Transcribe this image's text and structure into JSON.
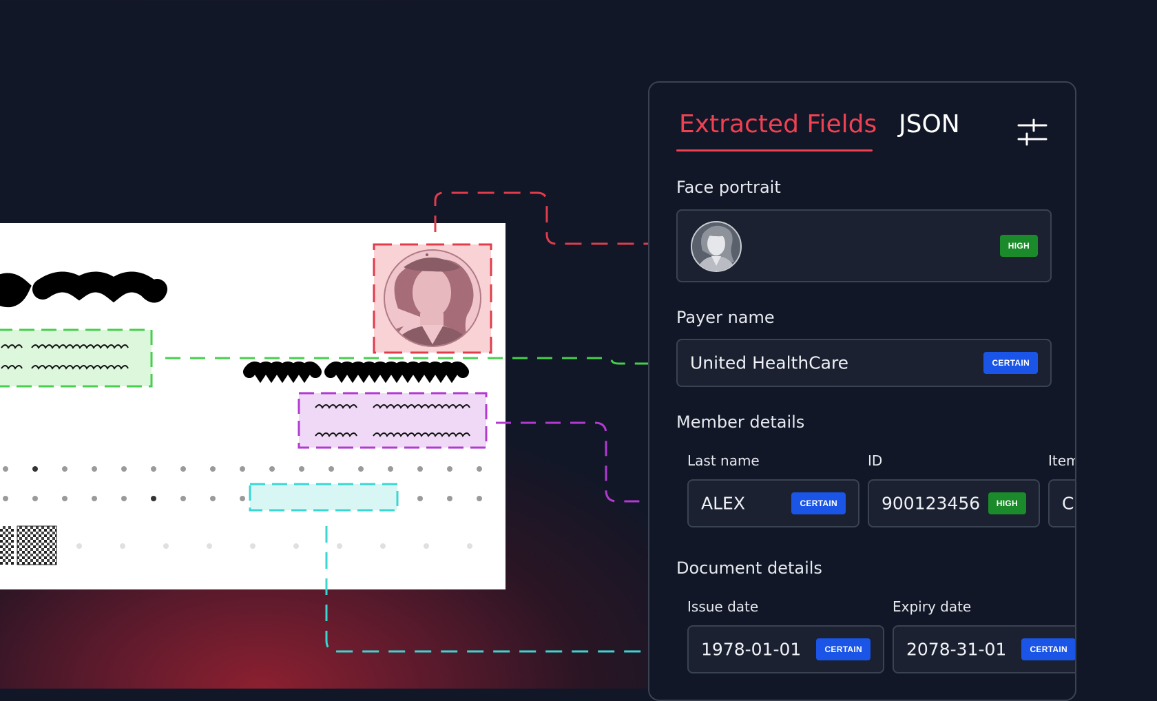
{
  "panel": {
    "tabs": [
      {
        "label": "Extracted Fields",
        "active": true
      },
      {
        "label": "JSON",
        "active": false
      }
    ],
    "settings_icon": "sliders-icon"
  },
  "sections": {
    "face": {
      "label": "Face portrait",
      "badge": "HIGH",
      "icon": "portrait-avatar-icon"
    },
    "payer": {
      "label": "Payer name",
      "value": "United HealthCare",
      "badge": "CERTAIN"
    },
    "member": {
      "label": "Member details",
      "fields": [
        {
          "label": "Last name",
          "value": "ALEX",
          "badge": "CERTAIN"
        },
        {
          "label": "ID",
          "value": "900123456",
          "badge": "HIGH"
        },
        {
          "label": "Item",
          "value": "CH",
          "badge": ""
        }
      ]
    },
    "document": {
      "label": "Document details",
      "fields": [
        {
          "label": "Issue date",
          "value": "1978-01-01",
          "badge": "CERTAIN"
        },
        {
          "label": "Expiry date",
          "value": "2078-31-01",
          "badge": "CERTAIN"
        }
      ]
    }
  },
  "colors": {
    "accent_red": "#ef4152",
    "badge_high": "#1b8a2a",
    "badge_certain": "#1a55e8",
    "link_green": "#3fd24a",
    "link_purple": "#b23ad1",
    "link_cyan": "#3ad6d2",
    "background": "#111727"
  }
}
